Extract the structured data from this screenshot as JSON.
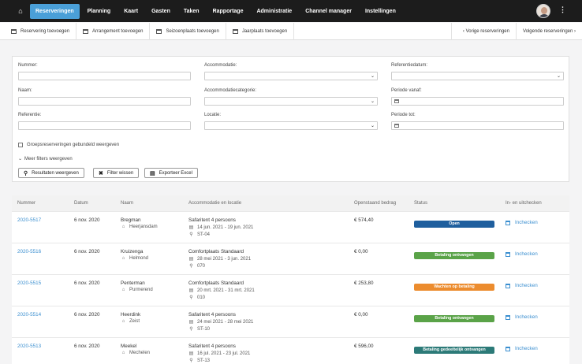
{
  "nav": {
    "home_icon": "home-icon",
    "items": [
      "Reserveringen",
      "Planning",
      "Kaart",
      "Gasten",
      "Taken",
      "Rapportage",
      "Administratie",
      "Channel manager",
      "Instellingen"
    ]
  },
  "toolbar": {
    "left": [
      "Reservering toevoegen",
      "Arrangement toevoegen",
      "Seizoenplaats toevoegen",
      "Jaarplaats toevoegen"
    ],
    "prev": "‹  Vorige reserveringen",
    "next": "Volgende reserveringen  ›"
  },
  "filters": {
    "nummer": "Nummer:",
    "naam": "Naam:",
    "referentie": "Referentie:",
    "accommodatie": "Accommodatie:",
    "accommodatiecategorie": "Accommodatiecategorie:",
    "locatie": "Locatie:",
    "referentiedatum": "Referentiedatum:",
    "periode_vanaf": "Periode vanaf:",
    "periode_tot": "Periode tot:",
    "groep_checkbox": "Groepsreserveringen gebundeld weergeven",
    "meer_filters": "Meer filters weergeven",
    "btn_resultaten": "Resultaten weergeven",
    "btn_wissen": "Filter wissen",
    "btn_excel": "Exporteer Excel"
  },
  "table": {
    "headers": [
      "Nummer",
      "Datum",
      "Naam",
      "Accommodatie en locatie",
      "Openstaand bedrag",
      "Status",
      "In- en uitchecken"
    ],
    "rows": [
      {
        "nummer": "2020-5517",
        "datum": "6 nov. 2020",
        "naam": "Bregman",
        "plaats": "Heerjansdam",
        "accommodatie": "Safaritent 4 persoons",
        "periode": "14 jun. 2021 - 19 jun. 2021",
        "locatie": "ST-04",
        "bedrag": "€ 574,40",
        "status": "Open",
        "status_color": "#1f5f9e",
        "checkin": "Inchecken"
      },
      {
        "nummer": "2020-5516",
        "datum": "6 nov. 2020",
        "naam": "Kruizenga",
        "plaats": "Helmond",
        "accommodatie": "Comfortplaats Standaard",
        "periode": "28 mei 2021 - 3 jun. 2021",
        "locatie": "070",
        "bedrag": "€ 0,00",
        "status": "Betaling ontvangen",
        "status_color": "#5aa348",
        "checkin": "Inchecken"
      },
      {
        "nummer": "2020-5515",
        "datum": "6 nov. 2020",
        "naam": "Penterman",
        "plaats": "Purmerend",
        "accommodatie": "Comfortplaats Standaard",
        "periode": "20 mrt. 2021 - 31 mrt. 2021",
        "locatie": "010",
        "bedrag": "€ 253,80",
        "status": "Wachten op betaling",
        "status_color": "#ec8c2e",
        "checkin": "Inchecken"
      },
      {
        "nummer": "2020-5514",
        "datum": "6 nov. 2020",
        "naam": "Heerdink",
        "plaats": "Zeist",
        "accommodatie": "Safaritent 4 persoons",
        "periode": "24 mei 2021 - 28 mei 2021",
        "locatie": "ST-10",
        "bedrag": "€ 0,00",
        "status": "Betaling ontvangen",
        "status_color": "#5aa348",
        "checkin": "Inchecken"
      },
      {
        "nummer": "2020-5513",
        "datum": "6 nov. 2020",
        "naam": "Meekel",
        "plaats": "Mechelen",
        "accommodatie": "Safaritent 4 persoons",
        "periode": "16 jul. 2021 - 23 jul. 2021",
        "locatie": "ST-13",
        "bedrag": "€ 596,00",
        "status": "Betaling gedeeltelijk ontvangen",
        "status_color": "#2c7a78",
        "checkin": "Inchecken"
      }
    ]
  }
}
